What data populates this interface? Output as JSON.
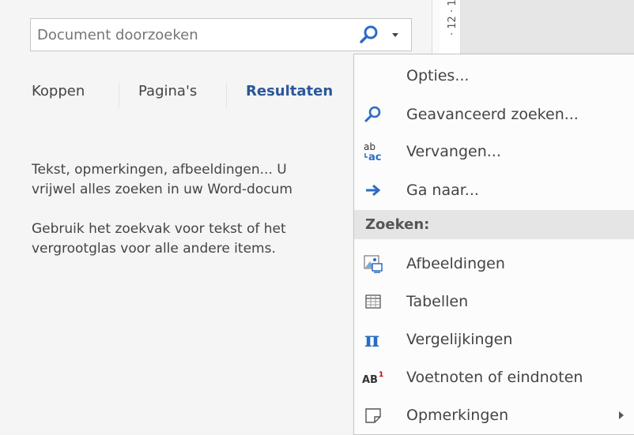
{
  "search": {
    "placeholder": "Document doorzoeken",
    "value": ""
  },
  "tabs": [
    {
      "label": "Koppen",
      "active": false
    },
    {
      "label": "Pagina's",
      "active": false
    },
    {
      "label": "Resultaten",
      "active": true
    }
  ],
  "help": {
    "line1": "Tekst, opmerkingen, afbeeldingen... U",
    "line2": "vrijwel alles zoeken in uw Word-docum",
    "line3": "Gebruik het zoekvak voor tekst of het",
    "line4": "vergrootglas voor alle andere items."
  },
  "ruler": {
    "label": "· 12 · 1"
  },
  "menu": {
    "options": {
      "label": "Opties..."
    },
    "advanced": {
      "label": "Geavanceerd zoeken..."
    },
    "replace": {
      "label": "Vervangen..."
    },
    "goto": {
      "label": "Ga naar..."
    },
    "section_label": "Zoeken:",
    "images": {
      "label": "Afbeeldingen"
    },
    "tables": {
      "label": "Tabellen"
    },
    "equations": {
      "label": "Vergelijkingen"
    },
    "footnotes": {
      "label": "Voetnoten of eindnoten"
    },
    "comments": {
      "label": "Opmerkingen"
    }
  },
  "icons": {
    "search": "search-icon",
    "dropdown": "chevron-down-icon",
    "advanced": "search-icon",
    "replace": "replace-icon",
    "goto": "arrow-right-icon",
    "images": "picture-icon",
    "tables": "table-icon",
    "equations": "pi-icon",
    "footnotes": "footnote-icon",
    "comments": "comment-icon",
    "submenu": "submenu-arrow-icon"
  },
  "colors": {
    "accent": "#2b579a",
    "icon_blue": "#2b6cc4",
    "menu_bg": "#fcfcfc",
    "section_bg": "#e5e5e5"
  }
}
